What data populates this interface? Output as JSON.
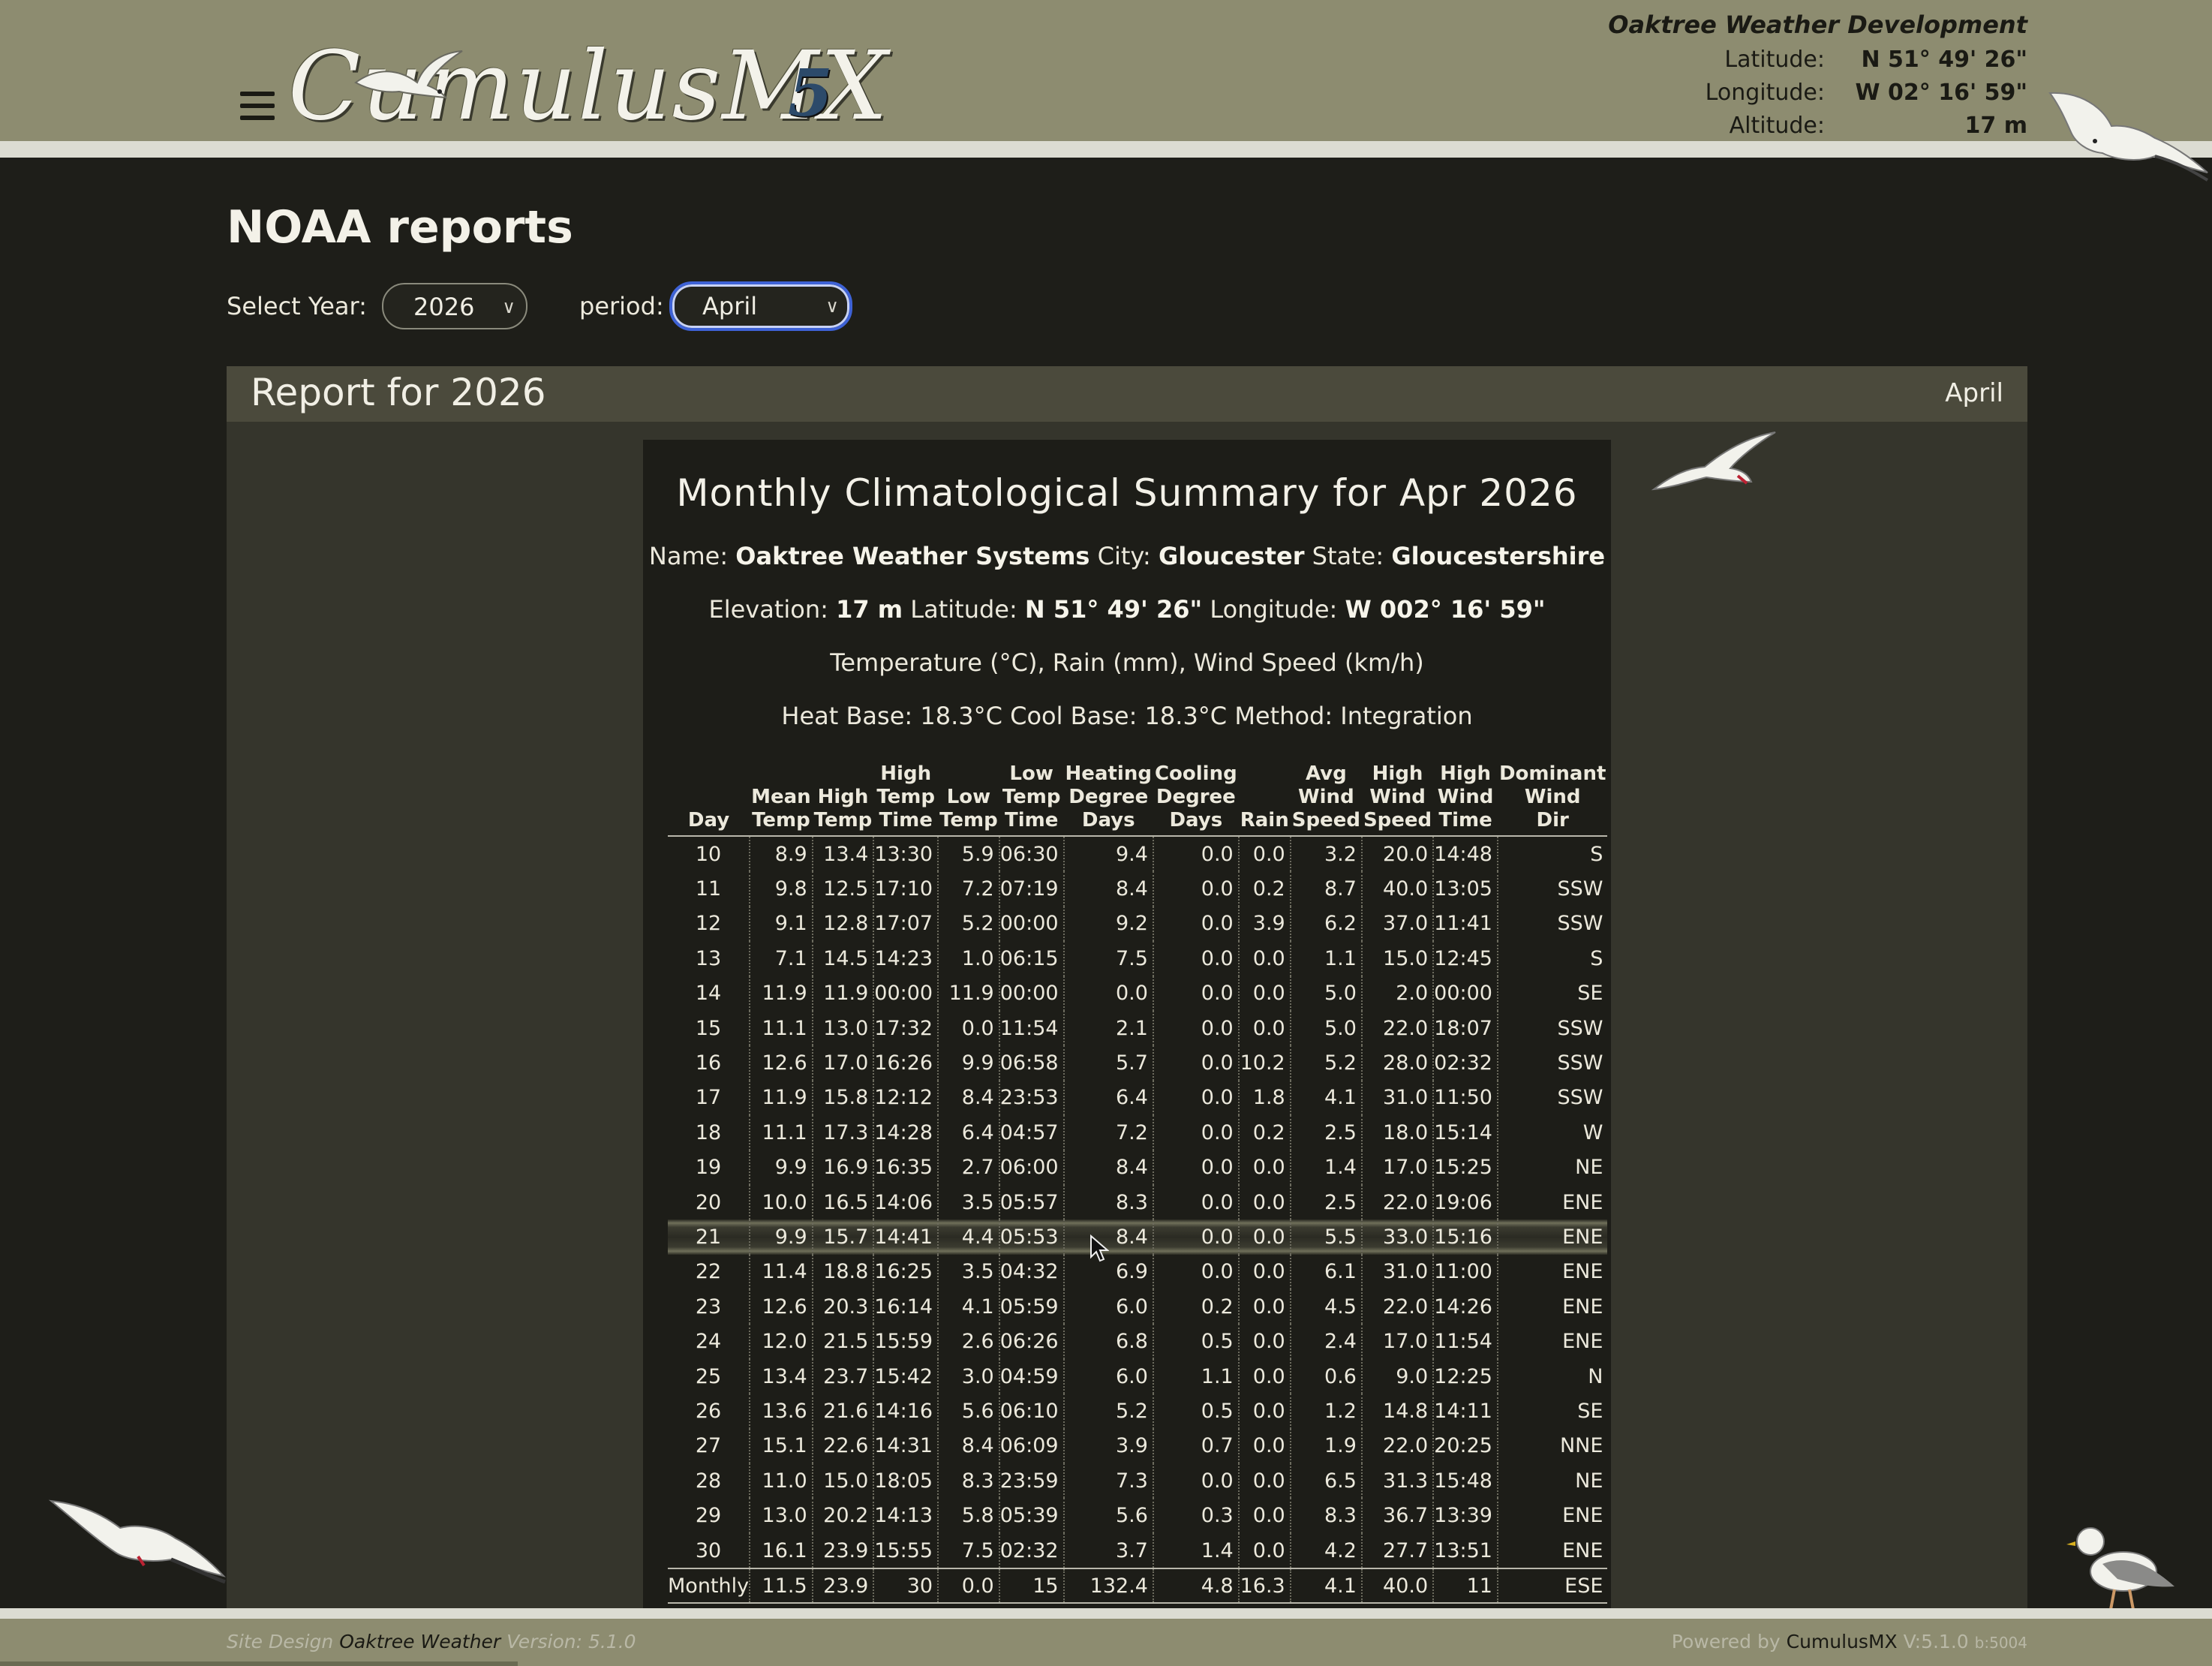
{
  "header": {
    "logo_text": "CumulusMX",
    "logo_version": "5",
    "station_name": "Oaktree Weather Development",
    "location": [
      {
        "label": "Latitude:",
        "value": "N 51° 49' 26\""
      },
      {
        "label": "Longitude:",
        "value": "W 02° 16' 59\""
      },
      {
        "label": "Altitude:",
        "value": "17 m"
      }
    ]
  },
  "page": {
    "title": "NOAA reports",
    "year_label": "Select Year:",
    "year_value": "2026",
    "period_label": "period:",
    "period_value": "April"
  },
  "panel": {
    "title": "Report for 2026",
    "period": "April"
  },
  "report": {
    "title": "Monthly Climatological Summary for Apr 2026",
    "line1": {
      "name_label": "Name:",
      "name": "Oaktree Weather Systems",
      "city_label": "City:",
      "city": "Gloucester",
      "state_label": "State:",
      "state": "Gloucestershire"
    },
    "line2": {
      "elev_label": "Elevation:",
      "elev": "17 m",
      "lat_label": "Latitude:",
      "lat": "N 51° 49' 26\"",
      "lon_label": "Longitude:",
      "lon": "W 002° 16' 59\""
    },
    "line3": "Temperature (°C), Rain (mm), Wind Speed (km/h)",
    "line4": "Heat Base: 18.3°C Cool Base: 18.3°C Method: Integration"
  },
  "table": {
    "headers": [
      [
        "Day"
      ],
      [
        "Mean",
        "Temp"
      ],
      [
        "High",
        "Temp"
      ],
      [
        "High",
        "Temp",
        "Time"
      ],
      [
        "Low",
        "Temp"
      ],
      [
        "Low",
        "Temp",
        "Time"
      ],
      [
        "Heating",
        "Degree",
        "Days"
      ],
      [
        "Cooling",
        "Degree",
        "Days"
      ],
      [
        "Rain"
      ],
      [
        "Avg",
        "Wind",
        "Speed"
      ],
      [
        "High",
        "Wind",
        "Speed"
      ],
      [
        "High",
        "Wind",
        "Time"
      ],
      [
        "Dominant",
        "Wind",
        "Dir"
      ]
    ],
    "rows": [
      [
        "10",
        "8.9",
        "13.4",
        "13:30",
        "5.9",
        "06:30",
        "9.4",
        "0.0",
        "0.0",
        "3.2",
        "20.0",
        "14:48",
        "S"
      ],
      [
        "11",
        "9.8",
        "12.5",
        "17:10",
        "7.2",
        "07:19",
        "8.4",
        "0.0",
        "0.2",
        "8.7",
        "40.0",
        "13:05",
        "SSW"
      ],
      [
        "12",
        "9.1",
        "12.8",
        "17:07",
        "5.2",
        "00:00",
        "9.2",
        "0.0",
        "3.9",
        "6.2",
        "37.0",
        "11:41",
        "SSW"
      ],
      [
        "13",
        "7.1",
        "14.5",
        "14:23",
        "1.0",
        "06:15",
        "7.5",
        "0.0",
        "0.0",
        "1.1",
        "15.0",
        "12:45",
        "S"
      ],
      [
        "14",
        "11.9",
        "11.9",
        "00:00",
        "11.9",
        "00:00",
        "0.0",
        "0.0",
        "0.0",
        "5.0",
        "2.0",
        "00:00",
        "SE"
      ],
      [
        "15",
        "11.1",
        "13.0",
        "17:32",
        "0.0",
        "11:54",
        "2.1",
        "0.0",
        "0.0",
        "5.0",
        "22.0",
        "18:07",
        "SSW"
      ],
      [
        "16",
        "12.6",
        "17.0",
        "16:26",
        "9.9",
        "06:58",
        "5.7",
        "0.0",
        "10.2",
        "5.2",
        "28.0",
        "02:32",
        "SSW"
      ],
      [
        "17",
        "11.9",
        "15.8",
        "12:12",
        "8.4",
        "23:53",
        "6.4",
        "0.0",
        "1.8",
        "4.1",
        "31.0",
        "11:50",
        "SSW"
      ],
      [
        "18",
        "11.1",
        "17.3",
        "14:28",
        "6.4",
        "04:57",
        "7.2",
        "0.0",
        "0.2",
        "2.5",
        "18.0",
        "15:14",
        "W"
      ],
      [
        "19",
        "9.9",
        "16.9",
        "16:35",
        "2.7",
        "06:00",
        "8.4",
        "0.0",
        "0.0",
        "1.4",
        "17.0",
        "15:25",
        "NE"
      ],
      [
        "20",
        "10.0",
        "16.5",
        "14:06",
        "3.5",
        "05:57",
        "8.3",
        "0.0",
        "0.0",
        "2.5",
        "22.0",
        "19:06",
        "ENE"
      ],
      [
        "21",
        "9.9",
        "15.7",
        "14:41",
        "4.4",
        "05:53",
        "8.4",
        "0.0",
        "0.0",
        "5.5",
        "33.0",
        "15:16",
        "ENE"
      ],
      [
        "22",
        "11.4",
        "18.8",
        "16:25",
        "3.5",
        "04:32",
        "6.9",
        "0.0",
        "0.0",
        "6.1",
        "31.0",
        "11:00",
        "ENE"
      ],
      [
        "23",
        "12.6",
        "20.3",
        "16:14",
        "4.1",
        "05:59",
        "6.0",
        "0.2",
        "0.0",
        "4.5",
        "22.0",
        "14:26",
        "ENE"
      ],
      [
        "24",
        "12.0",
        "21.5",
        "15:59",
        "2.6",
        "06:26",
        "6.8",
        "0.5",
        "0.0",
        "2.4",
        "17.0",
        "11:54",
        "ENE"
      ],
      [
        "25",
        "13.4",
        "23.7",
        "15:42",
        "3.0",
        "04:59",
        "6.0",
        "1.1",
        "0.0",
        "0.6",
        "9.0",
        "12:25",
        "N"
      ],
      [
        "26",
        "13.6",
        "21.6",
        "14:16",
        "5.6",
        "06:10",
        "5.2",
        "0.5",
        "0.0",
        "1.2",
        "14.8",
        "14:11",
        "SE"
      ],
      [
        "27",
        "15.1",
        "22.6",
        "14:31",
        "8.4",
        "06:09",
        "3.9",
        "0.7",
        "0.0",
        "1.9",
        "22.0",
        "20:25",
        "NNE"
      ],
      [
        "28",
        "11.0",
        "15.0",
        "18:05",
        "8.3",
        "23:59",
        "7.3",
        "0.0",
        "0.0",
        "6.5",
        "31.3",
        "15:48",
        "NE"
      ],
      [
        "29",
        "13.0",
        "20.2",
        "14:13",
        "5.8",
        "05:39",
        "5.6",
        "0.3",
        "0.0",
        "8.3",
        "36.7",
        "13:39",
        "ENE"
      ],
      [
        "30",
        "16.1",
        "23.9",
        "15:55",
        "7.5",
        "02:32",
        "3.7",
        "1.4",
        "0.0",
        "4.2",
        "27.7",
        "13:51",
        "ENE"
      ]
    ],
    "highlight_row_index": 11,
    "monthly": [
      "Monthly",
      "11.5",
      "23.9",
      "30",
      "0.0",
      "15",
      "132.4",
      "4.8",
      "16.3",
      "4.1",
      "40.0",
      "11",
      "ESE"
    ]
  },
  "footer": {
    "design_prefix": "Site Design",
    "design_name": "Oaktree Weather",
    "version": "Version: 5.1.0",
    "powered_prefix": "Powered by",
    "powered_name": "CumulusMX",
    "build": "V:5.1.0",
    "build_num": "b:5004"
  },
  "colors": {
    "header_bg": "#8d8c70",
    "page_bg": "#1e1e19",
    "panel_bg": "#35352c",
    "focus_ring": "#3e62d6"
  },
  "icons": [
    "menu-icon",
    "seagull-icon",
    "chevron-down-icon",
    "mouse-cursor-icon"
  ]
}
